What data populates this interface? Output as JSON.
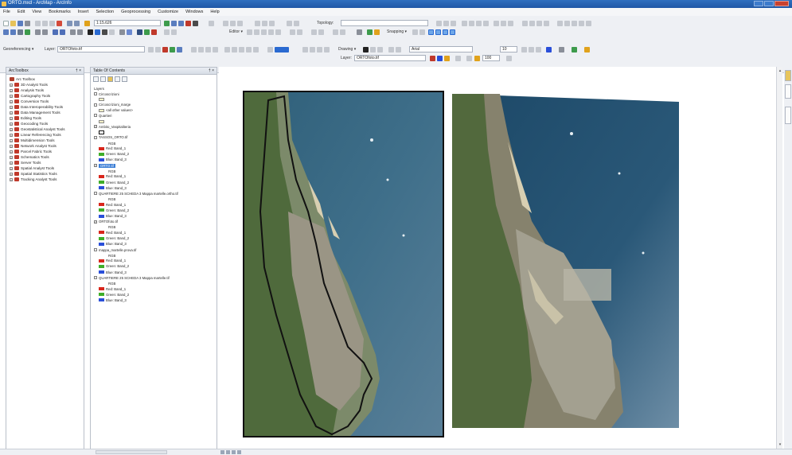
{
  "window": {
    "title": "ORTO.mxd - ArcMap - ArcInfo"
  },
  "menu": [
    "File",
    "Edit",
    "View",
    "Bookmarks",
    "Insert",
    "Selection",
    "Geoprocessing",
    "Customize",
    "Windows",
    "Help"
  ],
  "toolbar": {
    "scale": "1:15.626",
    "georef_label": "Georeferencing ▾",
    "layer_label": "Layer:",
    "layer_value": "ORTOfoto.tif",
    "editor_label": "Editor ▾",
    "topology_label": "Topology:",
    "snapping_label": "Snapping ▾",
    "drawing_label": "Drawing ▾",
    "font_name": "Arial",
    "font_size": "10",
    "layer2_label": "Layer:",
    "layer2_value": "ORTOfoto.tif",
    "zoom_value": "100"
  },
  "toolbox": {
    "title": "ArcToolbox",
    "pin": "† ×",
    "root": "Arc Toolbox",
    "items": [
      "3D Analyst Tools",
      "Analysis Tools",
      "Cartography Tools",
      "Conversion Tools",
      "Data Interoperability Tools",
      "Data Management Tools",
      "Editing Tools",
      "Geocoding Tools",
      "Geostatistical Analyst Tools",
      "Linear Referencing Tools",
      "Multidimension Tools",
      "Network Analyst Tools",
      "Parcel Fabric Tools",
      "Schematics Tools",
      "Server Tools",
      "Spatial Analyst Tools",
      "Spatial Statistics Tools",
      "Tracking Analyst Tools"
    ]
  },
  "toc": {
    "title": "Table Of Contents",
    "pin": "† ×",
    "layers_label": "Layers",
    "rows": [
      {
        "kind": "layer",
        "text": "Circoscrizioni",
        "checked": false
      },
      {
        "kind": "legend",
        "text": "",
        "color": "#f4f0c8"
      },
      {
        "kind": "layer",
        "text": "Circoscrizioni_marge",
        "checked": false
      },
      {
        "kind": "legend",
        "text": "<all other values>",
        "color": "#f4f0c8"
      },
      {
        "kind": "layer",
        "text": "Quartieri",
        "checked": false
      },
      {
        "kind": "legend",
        "text": "",
        "color": "#f4f0c8"
      },
      {
        "kind": "layer",
        "text": "Ambito_Vaspitaliteria",
        "checked": true
      },
      {
        "kind": "legend",
        "text": "",
        "color": "#ffffff",
        "bold": true
      },
      {
        "kind": "layer",
        "text": "TASSOS_ORTO.tif",
        "checked": false
      },
      {
        "kind": "sub",
        "text": "RGB"
      },
      {
        "kind": "band",
        "text": "Red:   Band_1",
        "color": "#d9261c"
      },
      {
        "kind": "band",
        "text": "Green: Band_2",
        "color": "#3fae2a"
      },
      {
        "kind": "band",
        "text": "Blue:   Band_3",
        "color": "#2a4fd9"
      },
      {
        "kind": "layer",
        "text": "ORTO.tif",
        "checked": true,
        "selected": true
      },
      {
        "kind": "sub",
        "text": "RGB"
      },
      {
        "kind": "band",
        "text": "Red:   Band_1",
        "color": "#d9261c"
      },
      {
        "kind": "band",
        "text": "Green: Band_2",
        "color": "#3fae2a"
      },
      {
        "kind": "band",
        "text": "Blue:   Band_3",
        "color": "#2a4fd9"
      },
      {
        "kind": "layer",
        "text": "QUARTIERE 25 SCHEDA 3 Mappa martelle.ortho.tif",
        "checked": false
      },
      {
        "kind": "sub",
        "text": "RGB"
      },
      {
        "kind": "band",
        "text": "Red:   Band_1",
        "color": "#d9261c"
      },
      {
        "kind": "band",
        "text": "Green: Band_2",
        "color": "#3fae2a"
      },
      {
        "kind": "band",
        "text": "Blue:   Band_3",
        "color": "#2a4fd9"
      },
      {
        "kind": "layer",
        "text": "ORTOfoto.tif",
        "checked": true
      },
      {
        "kind": "sub",
        "text": "RGB"
      },
      {
        "kind": "band",
        "text": "Red:   Band_1",
        "color": "#d9261c"
      },
      {
        "kind": "band",
        "text": "Green: Band_2",
        "color": "#3fae2a"
      },
      {
        "kind": "band",
        "text": "Blue:   Band_3",
        "color": "#2a4fd9"
      },
      {
        "kind": "layer",
        "text": "mappa_martelle.prova.tif",
        "checked": false
      },
      {
        "kind": "sub",
        "text": "RGB"
      },
      {
        "kind": "band",
        "text": "Red:   Band_1",
        "color": "#d9261c"
      },
      {
        "kind": "band",
        "text": "Green: Band_2",
        "color": "#3fae2a"
      },
      {
        "kind": "band",
        "text": "Blue:   Band_3",
        "color": "#2a4fd9"
      },
      {
        "kind": "layer",
        "text": "QUARTIERE 25 SCHEDA 3 Mappa martelle.tif",
        "checked": false
      },
      {
        "kind": "sub",
        "text": "RGB"
      },
      {
        "kind": "band",
        "text": "Red:   Band_1",
        "color": "#d9261c"
      },
      {
        "kind": "band",
        "text": "Green: Band_2",
        "color": "#3fae2a"
      },
      {
        "kind": "band",
        "text": "Blue:   Band_3",
        "color": "#2a4fd9"
      }
    ]
  },
  "colors": {
    "sea_dark": "#1f4a6a",
    "sea_light": "#4f7f98",
    "land": "#8c8b78",
    "vegetation": "#4f6a3c",
    "beach": "#d8cfb2",
    "selection": "#3d7fd6"
  }
}
